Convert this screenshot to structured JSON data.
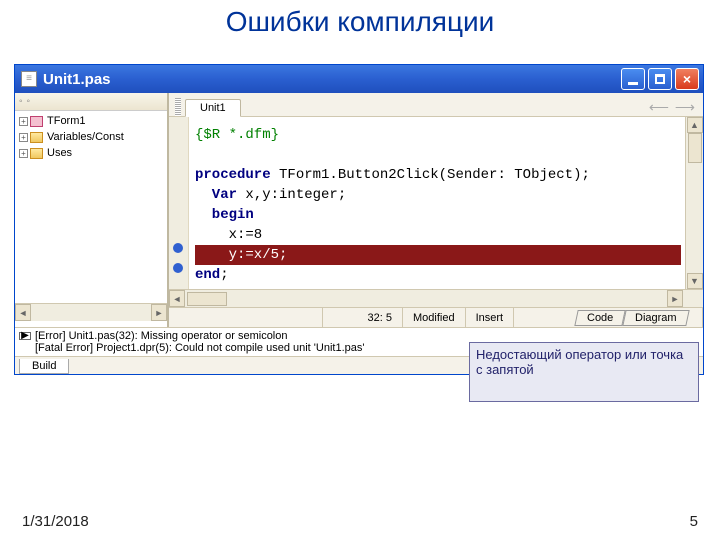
{
  "slide": {
    "title": "Ошибки компиляции",
    "date": "1/31/2018",
    "page": "5"
  },
  "window": {
    "title": "Unit1.pas"
  },
  "controls": {
    "min": "_",
    "max": "□",
    "close": "×"
  },
  "tree": {
    "items": [
      {
        "icon": "form-ic",
        "label": "TForm1"
      },
      {
        "icon": "fold-ic",
        "label": "Variables/Const"
      },
      {
        "icon": "fold-ic",
        "label": "Uses"
      }
    ]
  },
  "tabs": {
    "active": "Unit1",
    "nav_left": "←",
    "nav_right": "→",
    "back": "⟵",
    "fwd": "⟶"
  },
  "code": {
    "directive": "{$R *.dfm}",
    "proc_kw": "procedure",
    "proc_sig": " TForm1.Button2Click(Sender: TObject);",
    "var_kw": "  Var",
    "var_decl": " x,y:integer;",
    "begin_kw": "  begin",
    "line_x": "    x:=8",
    "err_line": "    y:=x/5;",
    "end_kw": "end",
    "semicolon": ";"
  },
  "status": {
    "pos": "32:  5",
    "mod": "Modified",
    "ins": "Insert"
  },
  "bottom_tabs": {
    "code": "Code",
    "diagram": "Diagram"
  },
  "messages": {
    "err1": "[Error] Unit1.pas(32): Missing operator or semicolon",
    "err2": "[Fatal Error] Project1.dpr(5): Could not compile used unit 'Unit1.pas'"
  },
  "callout": {
    "text": "Недостающий оператор или точка с запятой"
  },
  "build_tab": "Build",
  "glyphs": {
    "plus": "+",
    "up": "▲",
    "down": "▼",
    "left": "◄",
    "right": "►",
    "play": "▶"
  }
}
